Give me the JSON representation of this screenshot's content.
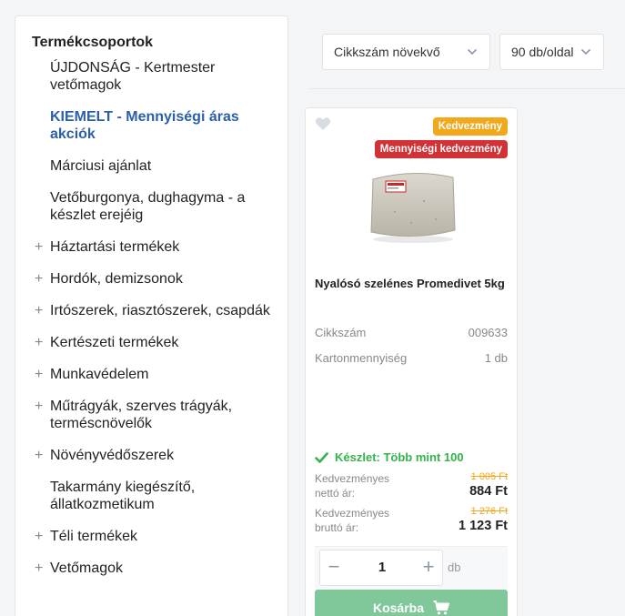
{
  "sidebar": {
    "title": "Termékcsoportok",
    "items": [
      {
        "label": "ÚJDONSÁG - Kertmester vetőmagok",
        "expandable": false,
        "active": false
      },
      {
        "label": "KIEMELT - Mennyiségi áras akciók",
        "expandable": false,
        "active": true
      },
      {
        "label": "Márciusi ajánlat",
        "expandable": false,
        "active": false
      },
      {
        "label": "Vetőburgonya, dughagyma - a készlet erejéig",
        "expandable": false,
        "active": false
      },
      {
        "label": "Háztartási termékek",
        "expandable": true,
        "active": false
      },
      {
        "label": "Hordók, demizsonok",
        "expandable": true,
        "active": false
      },
      {
        "label": "Irtószerek, riasztószerek, csapdák",
        "expandable": true,
        "active": false
      },
      {
        "label": "Kertészeti termékek",
        "expandable": true,
        "active": false
      },
      {
        "label": "Munkavédelem",
        "expandable": true,
        "active": false
      },
      {
        "label": "Műtrágyák, szerves trágyák, terméscnövelők",
        "expandable": true,
        "active": false
      },
      {
        "label": "Növényvédőszerek",
        "expandable": true,
        "active": false
      },
      {
        "label": "Takarmány kiegészítő, állatkozmetikum",
        "expandable": false,
        "active": false
      },
      {
        "label": "Téli termékek",
        "expandable": true,
        "active": false
      },
      {
        "label": "Vetőmagok",
        "expandable": true,
        "active": false
      }
    ]
  },
  "toolbar": {
    "sort_value": "Cikkszám növekvő",
    "per_page_value": "90 db/oldal"
  },
  "product": {
    "badge_discount": "Kedvezmény",
    "badge_quantity": "Mennyiségi kedvezmény",
    "name": "Nyalósó szelénes Promedivet 5kg",
    "sku_label": "Cikkszám",
    "sku_value": "009633",
    "carton_label": "Kartonmennyiség",
    "carton_value": "1 db",
    "stock": "Készlet: Több mint 100",
    "net_label": "Kedvezményes nettó ár:",
    "net_old": "1 005 Ft",
    "net_new": "884 Ft",
    "gross_label": "Kedvezményes bruttó ár:",
    "gross_old": "1 276 Ft",
    "gross_new": "1 123 Ft",
    "qty_value": "1",
    "qty_unit": "db",
    "cart_label": "Kosárba"
  },
  "colors": {
    "accent_blue": "#2b5fa8",
    "badge_orange": "#f2a81d",
    "badge_red": "#d23135",
    "stock_green": "#33b34a",
    "cart_green": "#80c79a"
  }
}
